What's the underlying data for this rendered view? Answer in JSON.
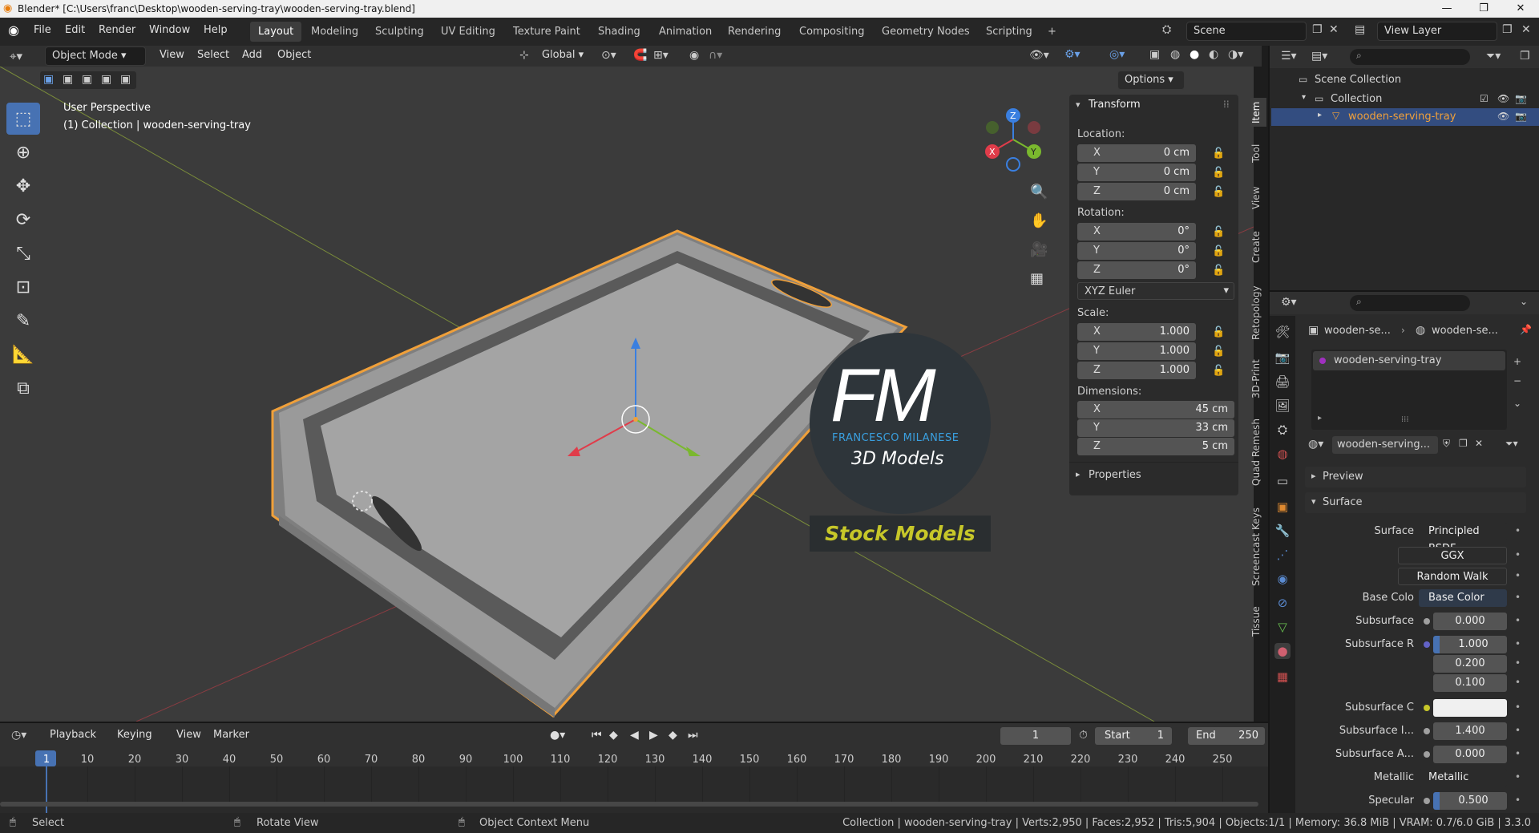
{
  "window": {
    "title": "Blender* [C:\\Users\\franc\\Desktop\\wooden-serving-tray\\wooden-serving-tray.blend]",
    "minimize": "—",
    "maximize": "❐",
    "close": "✕"
  },
  "menu": [
    "File",
    "Edit",
    "Render",
    "Window",
    "Help"
  ],
  "workspaces": [
    "Layout",
    "Modeling",
    "Sculpting",
    "UV Editing",
    "Texture Paint",
    "Shading",
    "Animation",
    "Rendering",
    "Compositing",
    "Geometry Nodes",
    "Scripting"
  ],
  "active_workspace": "Layout",
  "add_workspace": "+",
  "scene": {
    "label": "Scene",
    "view_layer": "View Layer"
  },
  "viewport_header": {
    "mode": "Object Mode",
    "menus": [
      "View",
      "Select",
      "Add",
      "Object"
    ],
    "orientation": "Global",
    "options": "Options"
  },
  "viewport": {
    "perspective": "User Perspective",
    "collection": "(1) Collection | wooden-serving-tray"
  },
  "watermark": {
    "logo": "FM",
    "name": "FRANCESCO MILANESE",
    "sub": "3D Models",
    "banner": "Stock Models"
  },
  "gizmo": {
    "x": "X",
    "y": "Y",
    "z": "Z"
  },
  "npanel": {
    "title": "Transform",
    "location_label": "Location:",
    "location": [
      [
        "X",
        "0 cm"
      ],
      [
        "Y",
        "0 cm"
      ],
      [
        "Z",
        "0 cm"
      ]
    ],
    "rotation_label": "Rotation:",
    "rotation": [
      [
        "X",
        "0°"
      ],
      [
        "Y",
        "0°"
      ],
      [
        "Z",
        "0°"
      ]
    ],
    "rotation_mode": "XYZ Euler",
    "scale_label": "Scale:",
    "scale": [
      [
        "X",
        "1.000"
      ],
      [
        "Y",
        "1.000"
      ],
      [
        "Z",
        "1.000"
      ]
    ],
    "dimensions_label": "Dimensions:",
    "dimensions": [
      [
        "X",
        "45 cm"
      ],
      [
        "Y",
        "33 cm"
      ],
      [
        "Z",
        "5 cm"
      ]
    ],
    "properties": "Properties"
  },
  "side_tabs": [
    "Item",
    "Tool",
    "View",
    "Create",
    "Retopology",
    "3D-Print",
    "Quad Remesh",
    "Screencast Keys",
    "Tissue"
  ],
  "outliner": {
    "root": "Scene Collection",
    "collection": "Collection",
    "object": "wooden-serving-tray"
  },
  "properties": {
    "breadcrumb_obj": "wooden-se...",
    "breadcrumb_mat": "wooden-se...",
    "material_slot": "wooden-serving-tray",
    "material_name": "wooden-serving...",
    "preview": "Preview",
    "surface_panel": "Surface",
    "rows": [
      {
        "label": "Surface",
        "value": "Principled BSDF",
        "dot": "#4fbf4f"
      },
      {
        "label": "",
        "value": "GGX",
        "dot": ""
      },
      {
        "label": "",
        "value": "Random Walk",
        "dot": ""
      },
      {
        "label": "Base Colo",
        "value": "Base Color",
        "dot": "#c7c729"
      },
      {
        "label": "Subsurface",
        "value": "0.000",
        "dot": "#a0a0a0"
      },
      {
        "label": "Subsurface R",
        "value": "1.000",
        "dot": "#6363c7"
      },
      {
        "label": "",
        "value": "0.200",
        "dot": ""
      },
      {
        "label": "",
        "value": "0.100",
        "dot": ""
      },
      {
        "label": "Subsurface C",
        "value": "",
        "dot": "#c7c729"
      },
      {
        "label": "Subsurface I...",
        "value": "1.400",
        "dot": "#a0a0a0"
      },
      {
        "label": "Subsurface A...",
        "value": "0.000",
        "dot": "#a0a0a0"
      },
      {
        "label": "Metallic",
        "value": "Metallic",
        "dot": "#a0a0a0"
      },
      {
        "label": "Specular",
        "value": "0.500",
        "dot": "#a0a0a0"
      }
    ]
  },
  "timeline": {
    "menus": [
      "Playback",
      "Keying",
      "View",
      "Marker"
    ],
    "current": "1",
    "start_label": "Start",
    "start": "1",
    "end_label": "End",
    "end": "250",
    "ticks": [
      "1",
      "10",
      "20",
      "30",
      "40",
      "50",
      "60",
      "70",
      "80",
      "90",
      "100",
      "110",
      "120",
      "130",
      "140",
      "150",
      "160",
      "170",
      "180",
      "190",
      "200",
      "210",
      "220",
      "230",
      "240",
      "250"
    ]
  },
  "status": {
    "select": "Select",
    "rotate": "Rotate View",
    "context": "Object Context Menu",
    "stats": "Collection | wooden-serving-tray | Verts:2,950 | Faces:2,952 | Tris:5,904 | Objects:1/1 | Memory: 36.8 MiB | VRAM: 0.7/6.0 GiB | 3.3.0"
  },
  "colors": {
    "accent": "#4772b3",
    "selection": "#f0a03a",
    "x_axis": "#e03c4a",
    "y_axis": "#7ab82e",
    "z_axis": "#3a7fe0"
  }
}
